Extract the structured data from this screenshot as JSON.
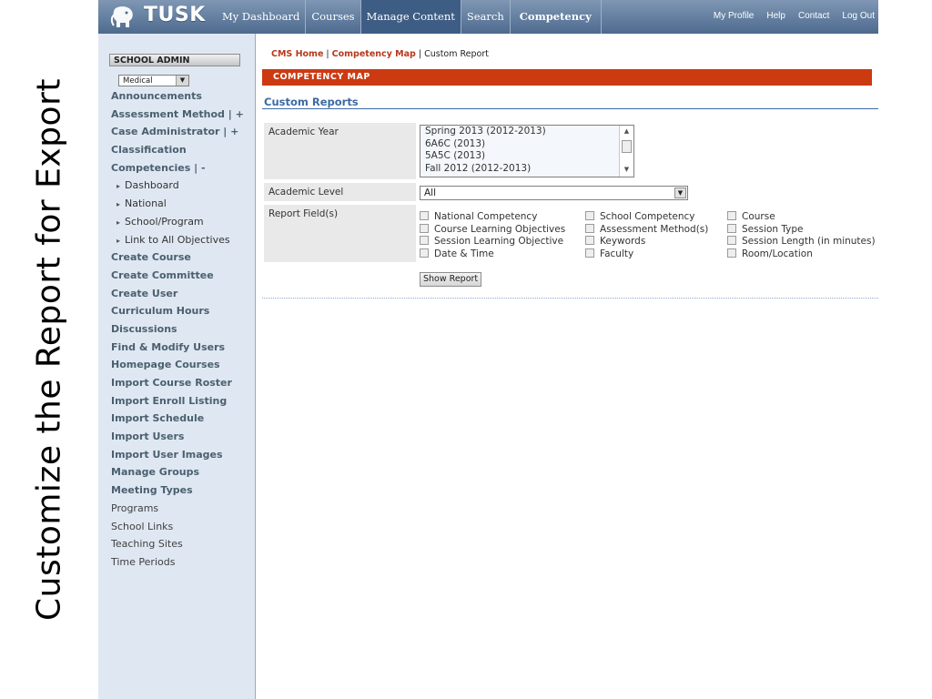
{
  "slide": {
    "caption": "Customize the Report for Export"
  },
  "header": {
    "logo": "TUSK",
    "nav": [
      "My Dashboard",
      "Courses",
      "Manage Content",
      "Search",
      "Competency"
    ],
    "util_nav": [
      "My Profile",
      "Help",
      "Contact",
      "Log Out"
    ]
  },
  "sidebar": {
    "school_admin": "SCHOOL ADMIN",
    "school_select": "Medical",
    "links": [
      "Announcements",
      "Assessment Method  | +",
      "Case Administrator | +",
      "Classification",
      "Competencies  | -",
      "Dashboard",
      "National",
      "School/Program",
      "Link to All Objectives",
      "Create Course",
      "Create Committee",
      "Create User",
      "Curriculum Hours",
      "Discussions",
      "Find & Modify Users",
      "Homepage Courses",
      "Import Course Roster",
      "Import Enroll Listing",
      "Import Schedule",
      "Import Users",
      "Import User Images",
      "Manage Groups",
      "Meeting Types",
      "Programs",
      "School Links",
      "Teaching Sites",
      "Time Periods"
    ]
  },
  "breadcrumb": {
    "cms_home": "CMS Home",
    "sep": " | ",
    "competency_map": "Competency Map",
    "current": "Custom Report"
  },
  "banner": "COMPETENCY MAP",
  "section_title": "Custom Reports",
  "form": {
    "academic_year_label": "Academic Year",
    "academic_year_options": [
      "Spring 2013 (2012-2013)",
      "6A6C (2013)",
      "5A5C (2013)",
      "Fall 2012 (2012-2013)"
    ],
    "academic_level_label": "Academic Level",
    "academic_level_value": "All",
    "report_fields_label": "Report Field(s)",
    "report_fields": {
      "col1": [
        "National Competency",
        "Course Learning Objectives",
        "Session Learning Objective",
        "Date & Time"
      ],
      "col2": [
        "School Competency",
        "Assessment Method(s)",
        "Keywords",
        "Faculty"
      ],
      "col3": [
        "Course",
        "Session Type",
        "Session Length (in minutes)",
        "Room/Location"
      ]
    },
    "show_report": "Show Report"
  },
  "icons": {
    "logo_mark": "tusk-elephant-icon",
    "dropdown": "chevron-down-icon"
  },
  "colors": {
    "nav_bar": "#5d7797",
    "banner": "#cc3a12",
    "link_red": "#b8381c",
    "section_blue": "#3d6aa3",
    "sidebar_bg": "#dfe8f2"
  }
}
